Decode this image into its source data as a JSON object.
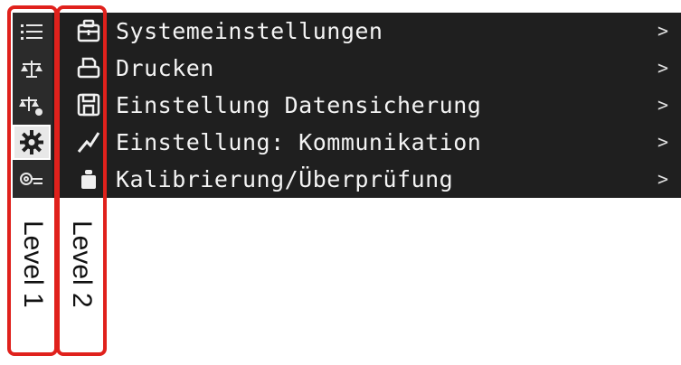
{
  "menu": {
    "items": [
      {
        "label": "Systemeinstellungen",
        "icon1": "list-icon",
        "icon2": "toolbox-icon",
        "chevron": ">"
      },
      {
        "label": "Drucken",
        "icon1": "balance-icon",
        "icon2": "printer-icon",
        "chevron": ">"
      },
      {
        "label": "Einstellung Datensicherung",
        "icon1": "balance-settings-icon",
        "icon2": "save-disk-icon",
        "chevron": ">"
      },
      {
        "label": "Einstellung: Kommunikation",
        "icon1": "gear-icon",
        "icon2": "signal-icon",
        "chevron": ">"
      },
      {
        "label": "Kalibrierung/Überprüfung",
        "icon1": "key-settings-icon",
        "icon2": "weight-icon",
        "chevron": ">"
      }
    ],
    "active_level1_index": 3
  },
  "annotations": {
    "level1": "Level 1",
    "level2": "Level 2"
  },
  "colors": {
    "panel": "#1f1f1f",
    "text": "#f4f4f4",
    "frame": "#e0211c"
  }
}
